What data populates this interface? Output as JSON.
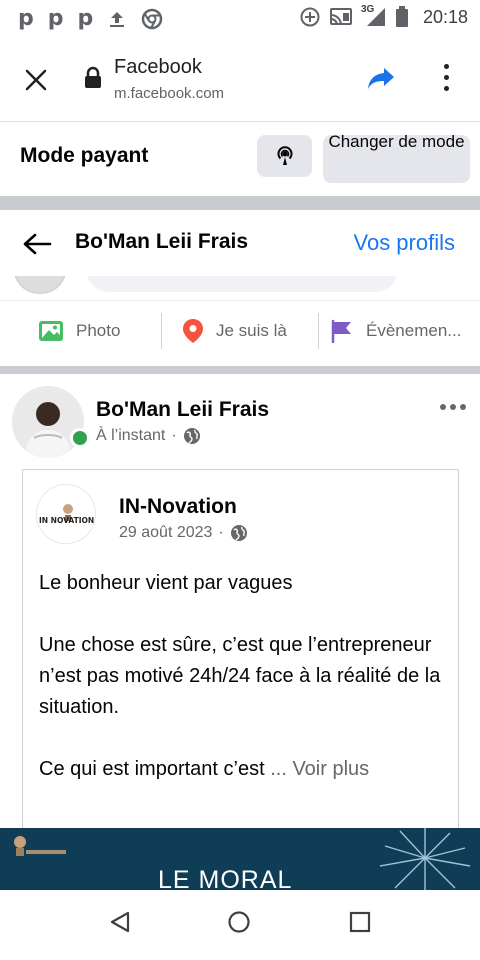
{
  "status_bar": {
    "left_icons": [
      "p",
      "p",
      "p"
    ],
    "network_label": "3G",
    "time": "20:18"
  },
  "browser": {
    "site_name": "Facebook",
    "site_url": "m.facebook.com"
  },
  "mode_bar": {
    "title": "Mode payant",
    "change_button": "Changer de mode"
  },
  "page_header": {
    "name": "Bo'Man Leii Frais",
    "profiles_link": "Vos profils"
  },
  "actions": {
    "photo": "Photo",
    "checkin": "Je suis là",
    "event": "Évènemen..."
  },
  "post": {
    "author": "Bo'Man Leii Frais",
    "time": "À l’instant",
    "separator": "·",
    "shared": {
      "author": "IN-Novation",
      "logo_text": "IN NOVATION",
      "date": "29 août 2023",
      "paragraphs": [
        "Le bonheur vient par vagues",
        "Une chose est sûre, c’est que l’entrepreneur n’est pas motivé 24h/24 face à la réalité de la situation.",
        "Ce qui est important c’est"
      ],
      "see_more": "... Voir plus"
    },
    "banner_title": "LE MORAL"
  },
  "colors": {
    "facebook_blue": "#1877f2",
    "online_green": "#31a24c",
    "banner_bg": "#0e3d55",
    "photo_green": "#45bd62",
    "checkin_red": "#f5533d",
    "event_purple": "#7f5cc5"
  }
}
